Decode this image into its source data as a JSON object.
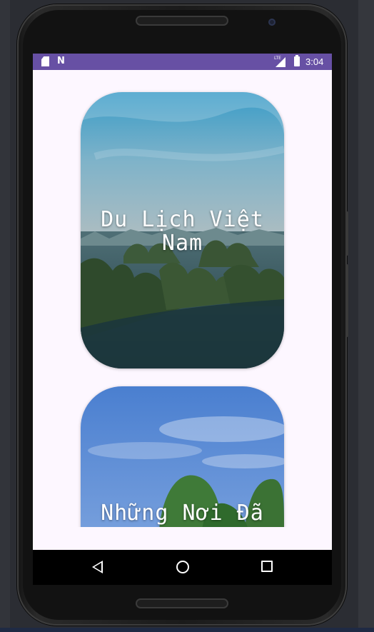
{
  "status_bar": {
    "time": "3:04",
    "network_label": "LTE",
    "icons": [
      "sim-card-icon",
      "notification-n-icon",
      "signal-icon",
      "battery-charging-icon"
    ]
  },
  "cards": [
    {
      "title": "Du Lịch Việt Nam",
      "image": "ha-long-bay-aerial-photo"
    },
    {
      "title": "Những Nơi Đã",
      "image": "limestone-karst-sky-photo"
    }
  ],
  "navigation": {
    "icons": [
      "back-icon",
      "home-icon",
      "recents-icon"
    ]
  },
  "colors": {
    "status_bar": "#6750a4",
    "screen_background": "#fdf7ff",
    "nav_bar": "#000000"
  }
}
